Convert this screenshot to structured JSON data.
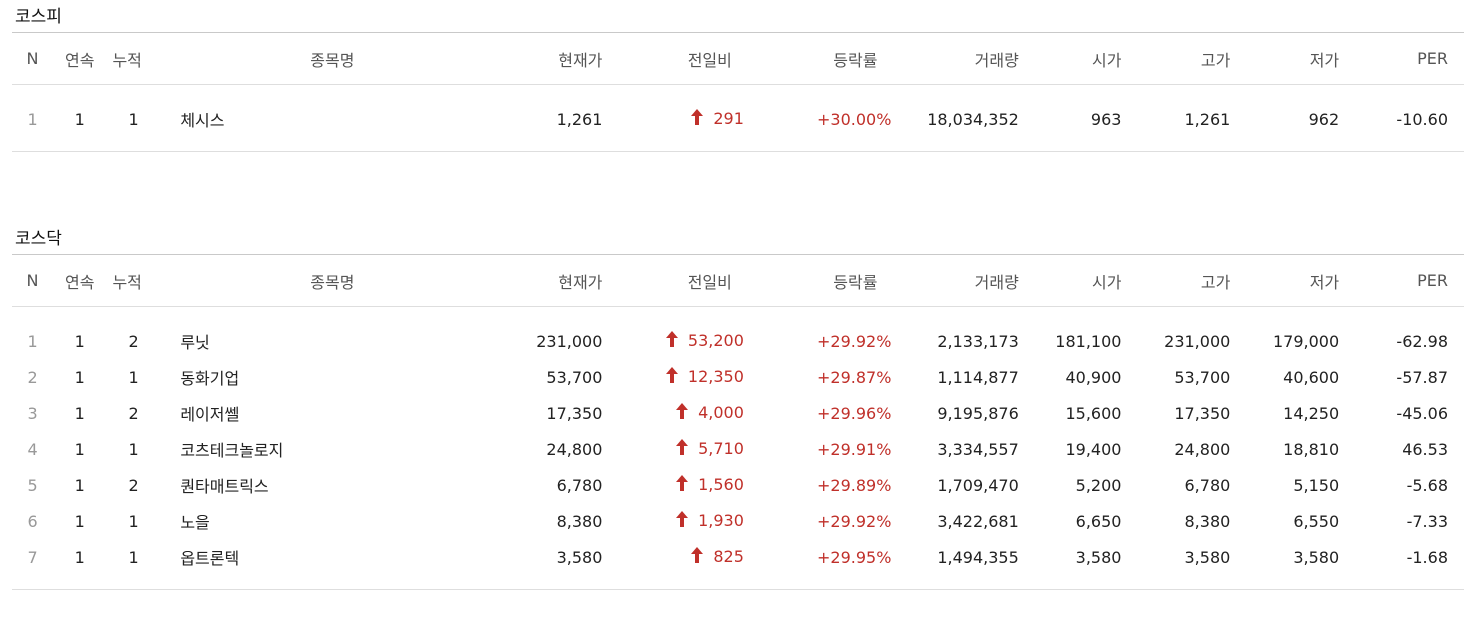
{
  "columns": {
    "n": "N",
    "consecutive": "연속",
    "cumulative": "누적",
    "name": "종목명",
    "price": "현재가",
    "change": "전일비",
    "rate": "등락률",
    "volume": "거래량",
    "open": "시가",
    "high": "고가",
    "low": "저가",
    "per": "PER"
  },
  "colors": {
    "up": "#c0302a",
    "rank": "#999999",
    "header_text": "#555555",
    "border": "#dedede"
  },
  "kospi": {
    "title": "코스피",
    "rows": [
      {
        "n": "1",
        "cons": "1",
        "cum": "1",
        "name": "체시스",
        "price": "1,261",
        "change": "291",
        "rate": "+30.00%",
        "volume": "18,034,352",
        "open": "963",
        "high": "1,261",
        "low": "962",
        "per": "-10.60"
      }
    ]
  },
  "kosdaq": {
    "title": "코스닥",
    "rows": [
      {
        "n": "1",
        "cons": "1",
        "cum": "2",
        "name": "루닛",
        "price": "231,000",
        "change": "53,200",
        "rate": "+29.92%",
        "volume": "2,133,173",
        "open": "181,100",
        "high": "231,000",
        "low": "179,000",
        "per": "-62.98"
      },
      {
        "n": "2",
        "cons": "1",
        "cum": "1",
        "name": "동화기업",
        "price": "53,700",
        "change": "12,350",
        "rate": "+29.87%",
        "volume": "1,114,877",
        "open": "40,900",
        "high": "53,700",
        "low": "40,600",
        "per": "-57.87"
      },
      {
        "n": "3",
        "cons": "1",
        "cum": "2",
        "name": "레이저쎌",
        "price": "17,350",
        "change": "4,000",
        "rate": "+29.96%",
        "volume": "9,195,876",
        "open": "15,600",
        "high": "17,350",
        "low": "14,250",
        "per": "-45.06"
      },
      {
        "n": "4",
        "cons": "1",
        "cum": "1",
        "name": "코츠테크놀로지",
        "price": "24,800",
        "change": "5,710",
        "rate": "+29.91%",
        "volume": "3,334,557",
        "open": "19,400",
        "high": "24,800",
        "low": "18,810",
        "per": "46.53"
      },
      {
        "n": "5",
        "cons": "1",
        "cum": "2",
        "name": "퀀타매트릭스",
        "price": "6,780",
        "change": "1,560",
        "rate": "+29.89%",
        "volume": "1,709,470",
        "open": "5,200",
        "high": "6,780",
        "low": "5,150",
        "per": "-5.68"
      },
      {
        "n": "6",
        "cons": "1",
        "cum": "1",
        "name": "노을",
        "price": "8,380",
        "change": "1,930",
        "rate": "+29.92%",
        "volume": "3,422,681",
        "open": "6,650",
        "high": "8,380",
        "low": "6,550",
        "per": "-7.33"
      },
      {
        "n": "7",
        "cons": "1",
        "cum": "1",
        "name": "옵트론텍",
        "price": "3,580",
        "change": "825",
        "rate": "+29.95%",
        "volume": "1,494,355",
        "open": "3,580",
        "high": "3,580",
        "low": "3,580",
        "per": "-1.68"
      }
    ]
  }
}
